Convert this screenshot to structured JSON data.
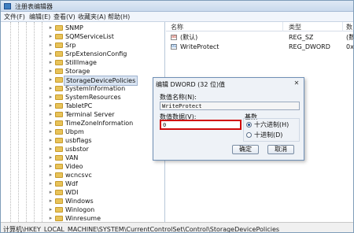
{
  "window": {
    "title": "注册表编辑器"
  },
  "menu": [
    "文件(F)",
    "编辑(E)",
    "查看(V)",
    "收藏夹(A)",
    "帮助(H)"
  ],
  "tree": {
    "items": [
      {
        "label": "SNMP",
        "selected": false
      },
      {
        "label": "SQMServiceList",
        "selected": false
      },
      {
        "label": "Srp",
        "selected": false
      },
      {
        "label": "SrpExtensionConfig",
        "selected": false
      },
      {
        "label": "StillImage",
        "selected": false
      },
      {
        "label": "Storage",
        "selected": false
      },
      {
        "label": "StorageDevicePolicies",
        "selected": true
      },
      {
        "label": "SystemInformation",
        "selected": false
      },
      {
        "label": "SystemResources",
        "selected": false
      },
      {
        "label": "TabletPC",
        "selected": false
      },
      {
        "label": "Terminal Server",
        "selected": false
      },
      {
        "label": "TimeZoneInformation",
        "selected": false
      },
      {
        "label": "Ubpm",
        "selected": false
      },
      {
        "label": "usbflags",
        "selected": false
      },
      {
        "label": "usbstor",
        "selected": false
      },
      {
        "label": "VAN",
        "selected": false
      },
      {
        "label": "Video",
        "selected": false
      },
      {
        "label": "wcncsvc",
        "selected": false
      },
      {
        "label": "Wdf",
        "selected": false
      },
      {
        "label": "WDI",
        "selected": false
      },
      {
        "label": "Windows",
        "selected": false
      },
      {
        "label": "Winlogon",
        "selected": false
      },
      {
        "label": "Winresume",
        "selected": false
      }
    ]
  },
  "list": {
    "columns": [
      "名称",
      "类型",
      "数"
    ],
    "rows": [
      {
        "name": "(默认)",
        "type": "REG_SZ",
        "data": "(数",
        "icon": "reg-sz-icon"
      },
      {
        "name": "WriteProtect",
        "type": "REG_DWORD",
        "data": "0x",
        "icon": "reg-dword-icon"
      }
    ]
  },
  "status": {
    "path": "计算机\\HKEY_LOCAL_MACHINE\\SYSTEM\\CurrentControlSet\\Control\\StorageDevicePolicies"
  },
  "dialog": {
    "title": "编辑 DWORD (32 位)值",
    "name_label": "数值名称(N):",
    "name_value": "WriteProtect",
    "data_label": "数值数据(V):",
    "data_value": "0",
    "base_label": "基数",
    "radio_hex": "十六进制(H)",
    "radio_dec": "十进制(D)",
    "ok": "确定",
    "cancel": "取消"
  },
  "colors": {
    "highlight_box": "#d10a0a",
    "folder": "#e8c35a",
    "selection": "#d9e4f2"
  }
}
